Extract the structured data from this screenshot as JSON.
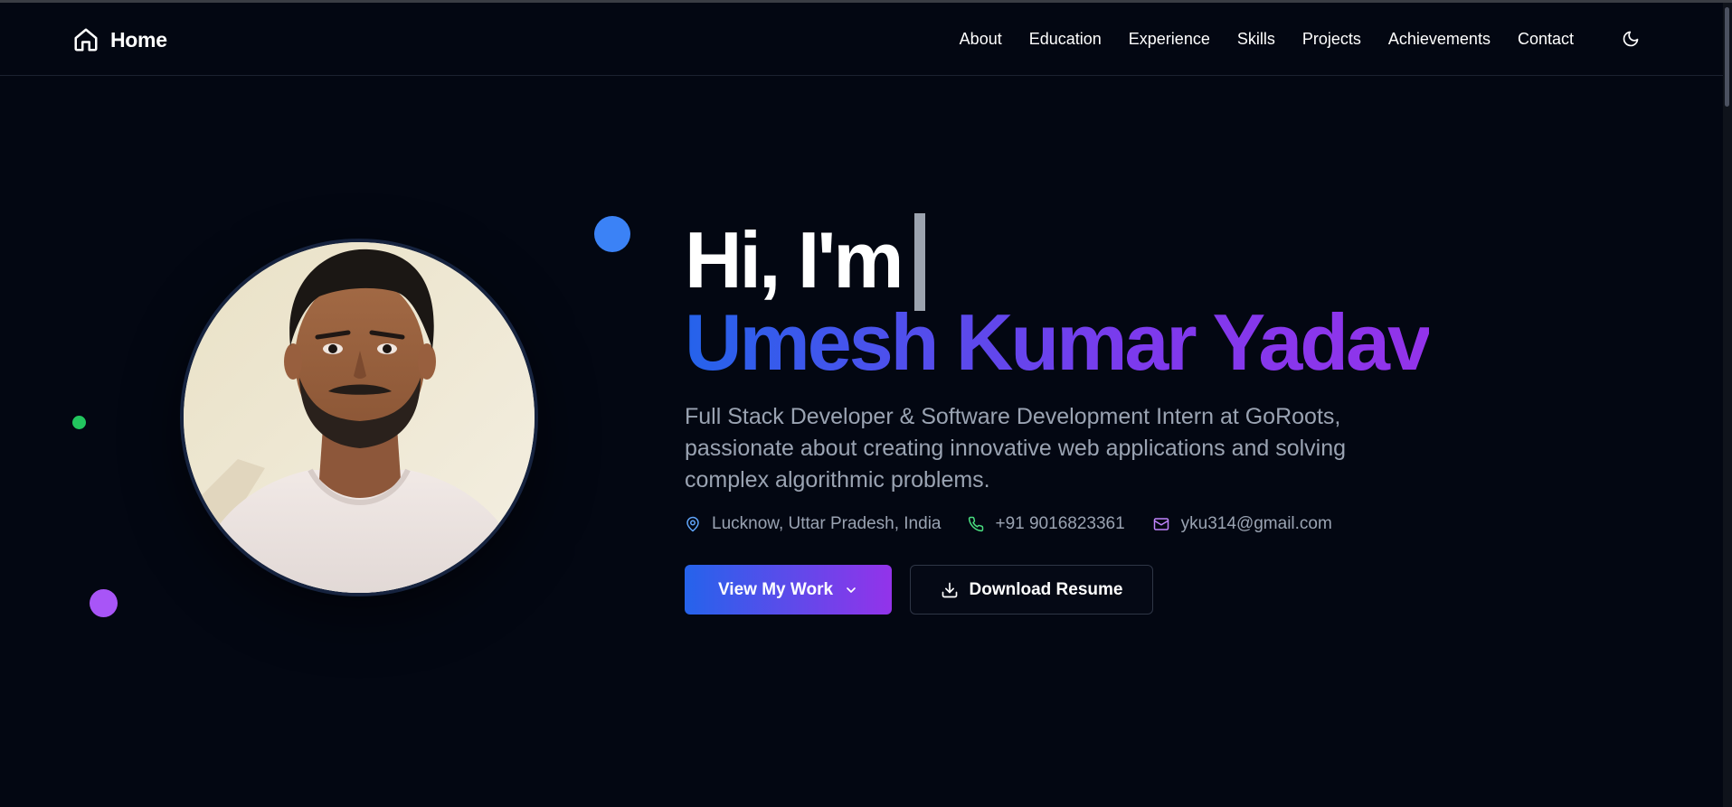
{
  "nav": {
    "brand_label": "Home",
    "links": [
      "About",
      "Education",
      "Experience",
      "Skills",
      "Projects",
      "Achievements",
      "Contact"
    ]
  },
  "hero": {
    "greeting": "Hi, I'm",
    "name": "Umesh Kumar Yadav",
    "bio": "Full Stack Developer & Software Development Intern at GoRoots, passionate about creating innovative web applications and solving complex algorithmic problems.",
    "contact": {
      "location": "Lucknow, Uttar Pradesh, India",
      "phone": "+91 9016823361",
      "email": "yku314@gmail.com"
    },
    "primary_button": "View My Work",
    "secondary_button": "Download Resume"
  },
  "colors": {
    "background": "#030712",
    "accent_blue": "#2563eb",
    "accent_purple": "#9333ea",
    "muted_text": "#9aa3b2"
  },
  "icons": {
    "brand": "home-icon",
    "theme": "moon-icon",
    "location": "map-pin-icon",
    "phone": "phone-icon",
    "email": "mail-icon",
    "primary_button": "chevron-down-icon",
    "secondary_button": "download-icon"
  }
}
